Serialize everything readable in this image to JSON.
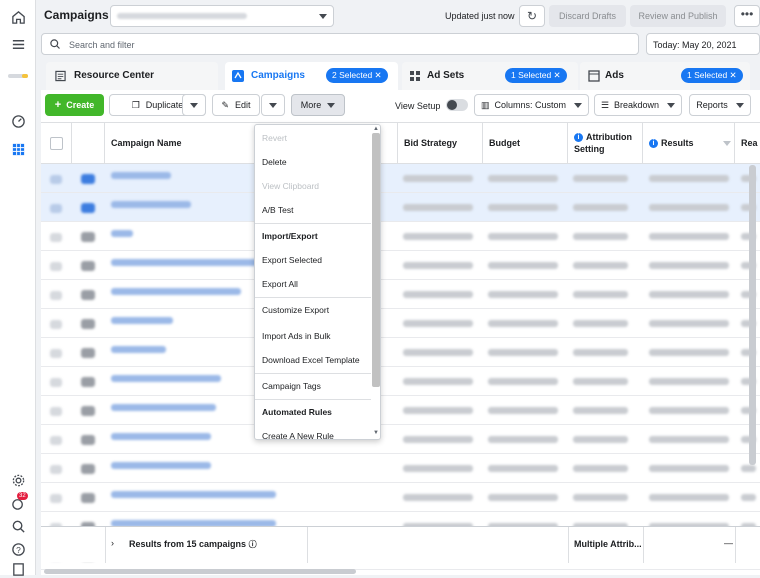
{
  "topbar": {
    "title": "Campaigns",
    "updated": "Updated just now",
    "discard_label": "Discard Drafts",
    "review_label": "Review and Publish",
    "more_label": "•••"
  },
  "search": {
    "placeholder": "Search and filter",
    "date": "Today: May 20, 2021"
  },
  "tabs": {
    "resource": "Resource Center",
    "campaigns": "Campaigns",
    "campaigns_selected": "2 Selected",
    "adsets": "Ad Sets",
    "adsets_selected": "1 Selected",
    "ads": "Ads",
    "ads_selected": "1 Selected"
  },
  "toolbar": {
    "create": "Create",
    "duplicate": "Duplicate",
    "edit": "Edit",
    "more": "More",
    "view_setup": "View Setup",
    "columns": "Columns: Custom",
    "breakdown": "Breakdown",
    "reports": "Reports"
  },
  "table": {
    "headers": {
      "name": "Campaign Name",
      "bid": "Bid Strategy",
      "budget": "Budget",
      "attr1": "Attribution",
      "attr2": "Setting",
      "results": "Results",
      "reach": "Rea"
    },
    "footer_label": "Results from 15 campaigns",
    "footer_attr": "Multiple Attrib...",
    "footer_dash": "—"
  },
  "menu": {
    "items": [
      {
        "label": "Revert",
        "state": "disabled"
      },
      {
        "label": "Delete",
        "state": "normal"
      },
      {
        "label": "View Clipboard",
        "state": "disabled"
      },
      {
        "label": "A/B Test",
        "state": "normal"
      },
      {
        "label": "Import/Export",
        "state": "header"
      },
      {
        "label": "Export Selected",
        "state": "normal"
      },
      {
        "label": "Export All",
        "state": "normal"
      },
      {
        "label": "Customize Export",
        "state": "normal"
      },
      {
        "label": "Import Ads in Bulk",
        "state": "normal"
      },
      {
        "label": "Download Excel Template",
        "state": "normal"
      },
      {
        "label": "Campaign Tags",
        "state": "normal"
      },
      {
        "label": "Automated Rules",
        "state": "header"
      },
      {
        "label": "Create A New Rule",
        "state": "normal"
      }
    ]
  },
  "sidebar": {
    "notification_count": "32"
  },
  "colors": {
    "accent": "#1877f2",
    "create": "#42b72a",
    "selected_row": "#e7f0fd"
  }
}
